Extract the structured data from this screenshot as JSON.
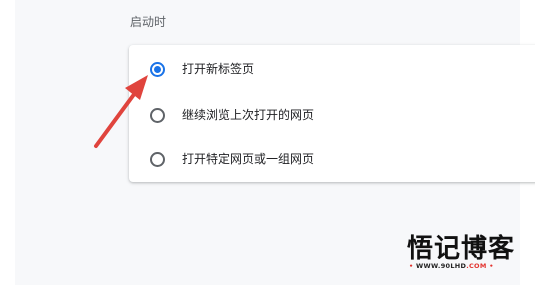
{
  "section": {
    "title": "启动时"
  },
  "startup_options": [
    {
      "label": "打开新标签页",
      "selected": true
    },
    {
      "label": "继续浏览上次打开的网页",
      "selected": false
    },
    {
      "label": "打开特定网页或一组网页",
      "selected": false
    }
  ],
  "watermark": {
    "logo_text": "悟记博客",
    "url_prefix": "WWW.",
    "url_mid": "90LHD",
    "url_suffix": ".COM",
    "accent_color": "#e3342f"
  },
  "annotation": {
    "arrow_color": "#e0443d"
  },
  "colors": {
    "radio_selected": "#1a73e8",
    "panel_bg": "#f7f8fa"
  }
}
